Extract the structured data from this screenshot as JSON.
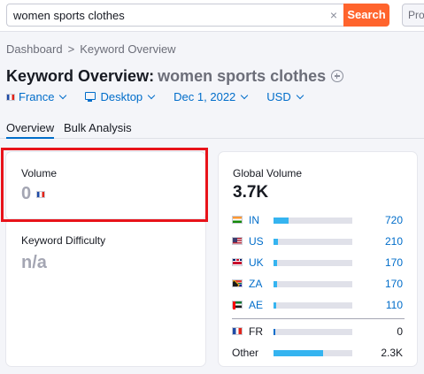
{
  "search": {
    "value": "women sports clothes",
    "clear_label": "×",
    "button_label": "Search",
    "pro_label": "Pro"
  },
  "breadcrumb": {
    "home": "Dashboard",
    "separator": ">",
    "current": "Keyword Overview"
  },
  "title": {
    "prefix": "Keyword Overview:",
    "keyword": "women sports clothes"
  },
  "filters": {
    "database": "France",
    "device": "Desktop",
    "date": "Dec 1, 2022",
    "currency": "USD"
  },
  "tabs": [
    {
      "label": "Overview"
    },
    {
      "label": "Bulk Analysis"
    }
  ],
  "volume": {
    "label": "Volume",
    "value": "0"
  },
  "keyword_difficulty": {
    "label": "Keyword Difficulty",
    "value": "n/a"
  },
  "global_volume": {
    "label": "Global Volume",
    "value": "3.7K",
    "countries": [
      {
        "code": "IN",
        "value": "720",
        "share": 0.19
      },
      {
        "code": "US",
        "value": "210",
        "share": 0.06
      },
      {
        "code": "UK",
        "value": "170",
        "share": 0.04
      },
      {
        "code": "ZA",
        "value": "170",
        "share": 0.04
      },
      {
        "code": "AE",
        "value": "110",
        "share": 0.03
      }
    ],
    "current": {
      "code": "FR",
      "value": "0",
      "share": 0.0
    },
    "other": {
      "label": "Other",
      "value": "2.3K",
      "share": 0.63
    }
  },
  "colors": {
    "accent": "#006dca",
    "search_button": "#ff642d",
    "bar_fill": "#35b4f0",
    "highlight": "#e8131a"
  }
}
